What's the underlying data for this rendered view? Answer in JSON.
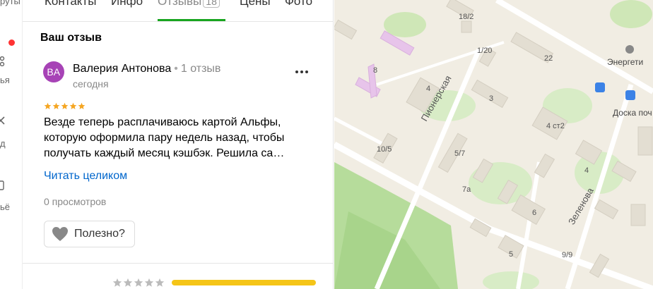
{
  "rail": {
    "fragments": [
      "руты",
      "ья",
      "д",
      "ьё"
    ]
  },
  "tabs": [
    {
      "label": "Контакты"
    },
    {
      "label": "Инфо"
    },
    {
      "label": "Отзывы",
      "badge": "18"
    },
    {
      "label": "Цены"
    },
    {
      "label": "Фото"
    }
  ],
  "review": {
    "section_title": "Ваш отзыв",
    "avatar_initials": "ВА",
    "avatar_color": "#a743b6",
    "author_name": "Валерия Антонова",
    "separator": "•",
    "author_reviews": "1 отзыв",
    "date": "сегодня",
    "rating": 5,
    "text": "Везде теперь расплачиваюсь картой Альфы, которую оформила пару недель назад, чтобы получать каждый месяц кэшбэк. Решила са…",
    "read_more": "Читать целиком",
    "views": "0 просмотров",
    "useful_label": "Полезно?"
  },
  "rating_summary": {
    "bar_color": "#f5c518"
  },
  "map": {
    "building_numbers": [
      "18/2",
      "1/20",
      "22",
      "8",
      "4",
      "3",
      "4 ст2",
      "10/5",
      "5/7",
      "7а",
      "4",
      "6",
      "5",
      "9/9"
    ],
    "streets": [
      "Пионерская",
      "Зеленова"
    ],
    "pois": [
      "Энергети",
      "Доска поч"
    ]
  }
}
